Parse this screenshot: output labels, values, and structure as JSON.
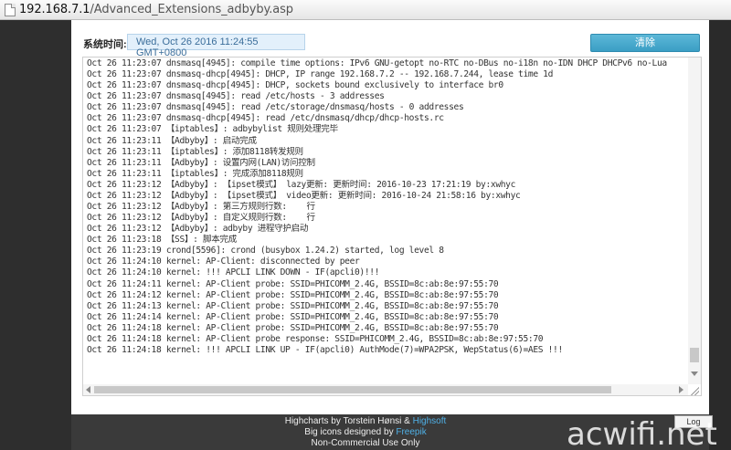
{
  "address_bar": {
    "host": "192.168.7.1",
    "path": "/Advanced_Extensions_adbyby.asp"
  },
  "dialog": {
    "time_label": "系统时间:",
    "time_value": "Wed, Oct 26 2016 11:24:55 GMT+0800",
    "clear_label": "清除"
  },
  "log": {
    "lines": [
      "Oct 26 11:23:07 dnsmasq[4945]: compile time options: IPv6 GNU-getopt no-RTC no-DBus no-i18n no-IDN DHCP DHCPv6 no-Lua",
      "Oct 26 11:23:07 dnsmasq-dhcp[4945]: DHCP, IP range 192.168.7.2 -- 192.168.7.244, lease time 1d",
      "Oct 26 11:23:07 dnsmasq-dhcp[4945]: DHCP, sockets bound exclusively to interface br0",
      "Oct 26 11:23:07 dnsmasq[4945]: read /etc/hosts - 3 addresses",
      "Oct 26 11:23:07 dnsmasq[4945]: read /etc/storage/dnsmasq/hosts - 0 addresses",
      "Oct 26 11:23:07 dnsmasq-dhcp[4945]: read /etc/dnsmasq/dhcp/dhcp-hosts.rc",
      "Oct 26 11:23:07 【iptables】: adbybylist 规则处理完毕",
      "Oct 26 11:23:11 【Adbyby】: 启动完成",
      "Oct 26 11:23:11 【iptables】: 添加8118转发规则",
      "Oct 26 11:23:11 【Adbyby】: 设置内网(LAN)访问控制",
      "Oct 26 11:23:11 【iptables】: 完成添加8118规则",
      "Oct 26 11:23:12 【Adbyby】: 【ipset模式】 lazy更新: 更新时间: 2016-10-23 17:21:19 by:xwhyc",
      "Oct 26 11:23:12 【Adbyby】: 【ipset模式】 video更新: 更新时间: 2016-10-24 21:58:16 by:xwhyc",
      "Oct 26 11:23:12 【Adbyby】: 第三方规则行数:    行",
      "Oct 26 11:23:12 【Adbyby】: 自定义规则行数:    行",
      "Oct 26 11:23:12 【Adbyby】: adbyby 进程守护启动",
      "Oct 26 11:23:18 【SS】: 脚本完成",
      "Oct 26 11:23:19 crond[5596]: crond (busybox 1.24.2) started, log level 8",
      "Oct 26 11:24:10 kernel: AP-Client: disconnected by peer",
      "Oct 26 11:24:10 kernel: !!! APCLI LINK DOWN - IF(apcli0)!!!",
      "Oct 26 11:24:11 kernel: AP-Client probe: SSID=PHICOMM_2.4G, BSSID=8c:ab:8e:97:55:70",
      "Oct 26 11:24:12 kernel: AP-Client probe: SSID=PHICOMM_2.4G, BSSID=8c:ab:8e:97:55:70",
      "Oct 26 11:24:13 kernel: AP-Client probe: SSID=PHICOMM_2.4G, BSSID=8c:ab:8e:97:55:70",
      "Oct 26 11:24:14 kernel: AP-Client probe: SSID=PHICOMM_2.4G, BSSID=8c:ab:8e:97:55:70",
      "Oct 26 11:24:18 kernel: AP-Client probe: SSID=PHICOMM_2.4G, BSSID=8c:ab:8e:97:55:70",
      "Oct 26 11:24:18 kernel: AP-Client probe response: SSID=PHICOMM_2.4G, BSSID=8c:ab:8e:97:55:70",
      "Oct 26 11:24:18 kernel: !!! APCLI LINK UP - IF(apcli0) AuthMode(7)=WPA2PSK, WepStatus(6)=AES !!!"
    ]
  },
  "footer": {
    "line1_prefix": "Highcharts by Torstein Hønsi & ",
    "line1_link": "Highsoft",
    "line2_prefix": "Big icons designed by ",
    "line2_link": "Freepik",
    "line3": "Non-Commercial Use Only",
    "log_button": "Log"
  },
  "watermark": "acwifi.net",
  "colors": {
    "accent_button": "#3a9ec4",
    "time_field_bg": "#e3f0fb",
    "footer_link": "#4fb0e6"
  }
}
